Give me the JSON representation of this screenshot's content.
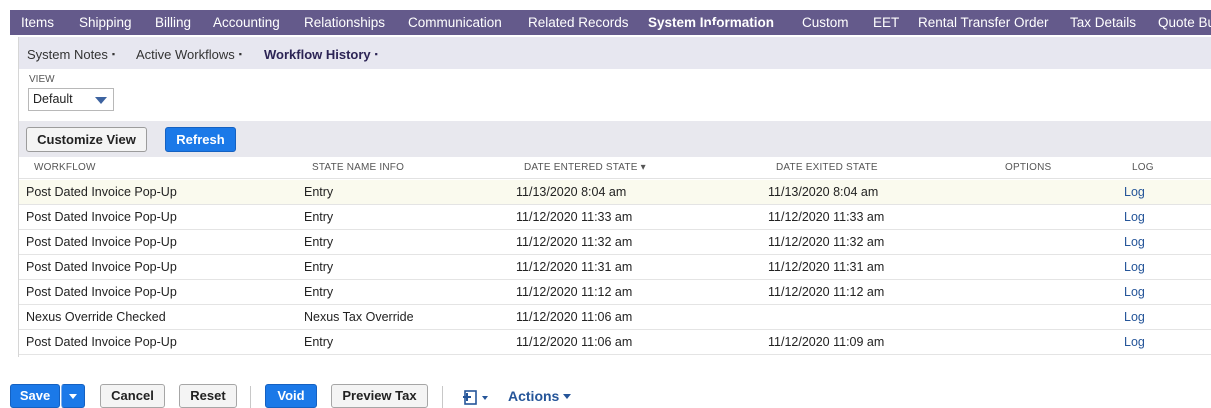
{
  "tabs": [
    {
      "label": "Items",
      "active": false
    },
    {
      "label": "Shipping",
      "active": false
    },
    {
      "label": "Billing",
      "active": false
    },
    {
      "label": "Accounting",
      "active": false
    },
    {
      "label": "Relationships",
      "active": false
    },
    {
      "label": "Communication",
      "active": false
    },
    {
      "label": "Related Records",
      "active": false
    },
    {
      "label": "System Information",
      "active": true
    },
    {
      "label": "Custom",
      "active": false
    },
    {
      "label": "EET",
      "active": false
    },
    {
      "label": "Rental Transfer Order",
      "active": false
    },
    {
      "label": "Tax Details",
      "active": false
    },
    {
      "label": "Quote Bu",
      "active": false
    }
  ],
  "subtabs": [
    {
      "label": "System Notes",
      "active": false
    },
    {
      "label": "Active Workflows",
      "active": false
    },
    {
      "label": "Workflow History",
      "active": true
    }
  ],
  "subtab_marker": "▪",
  "view": {
    "label": "VIEW",
    "selected": "Default"
  },
  "toolbar": {
    "customize_label": "Customize View",
    "refresh_label": "Refresh"
  },
  "table": {
    "headers": [
      "WORKFLOW",
      "STATE NAME INFO",
      "DATE ENTERED STATE ▾",
      "DATE EXITED STATE",
      "OPTIONS",
      "LOG"
    ],
    "rows": [
      {
        "workflow": "Post Dated Invoice Pop-Up",
        "state": "Entry",
        "entered": "11/13/2020 8:04 am",
        "exited": "11/13/2020 8:04 am",
        "options": "",
        "log": "Log"
      },
      {
        "workflow": "Post Dated Invoice Pop-Up",
        "state": "Entry",
        "entered": "11/12/2020 11:33 am",
        "exited": "11/12/2020 11:33 am",
        "options": "",
        "log": "Log"
      },
      {
        "workflow": "Post Dated Invoice Pop-Up",
        "state": "Entry",
        "entered": "11/12/2020 11:32 am",
        "exited": "11/12/2020 11:32 am",
        "options": "",
        "log": "Log"
      },
      {
        "workflow": "Post Dated Invoice Pop-Up",
        "state": "Entry",
        "entered": "11/12/2020 11:31 am",
        "exited": "11/12/2020 11:31 am",
        "options": "",
        "log": "Log"
      },
      {
        "workflow": "Post Dated Invoice Pop-Up",
        "state": "Entry",
        "entered": "11/12/2020 11:12 am",
        "exited": "11/12/2020 11:12 am",
        "options": "",
        "log": "Log"
      },
      {
        "workflow": "Nexus Override Checked",
        "state": "Nexus Tax Override",
        "entered": "11/12/2020 11:06 am",
        "exited": "",
        "options": "",
        "log": "Log"
      },
      {
        "workflow": "Post Dated Invoice Pop-Up",
        "state": "Entry",
        "entered": "11/12/2020 11:06 am",
        "exited": "11/12/2020 11:09 am",
        "options": "",
        "log": "Log"
      }
    ]
  },
  "bottom": {
    "save_label": "Save",
    "cancel_label": "Cancel",
    "reset_label": "Reset",
    "void_label": "Void",
    "preview_tax_label": "Preview Tax",
    "actions_label": "Actions"
  },
  "icons": {
    "print": "print-icon",
    "dropdown": "chevron-down-icon"
  },
  "colors": {
    "tabbar": "#645a8b",
    "primary_button": "#1b79e8",
    "link": "#255599",
    "highlight_row": "#fafaee"
  }
}
